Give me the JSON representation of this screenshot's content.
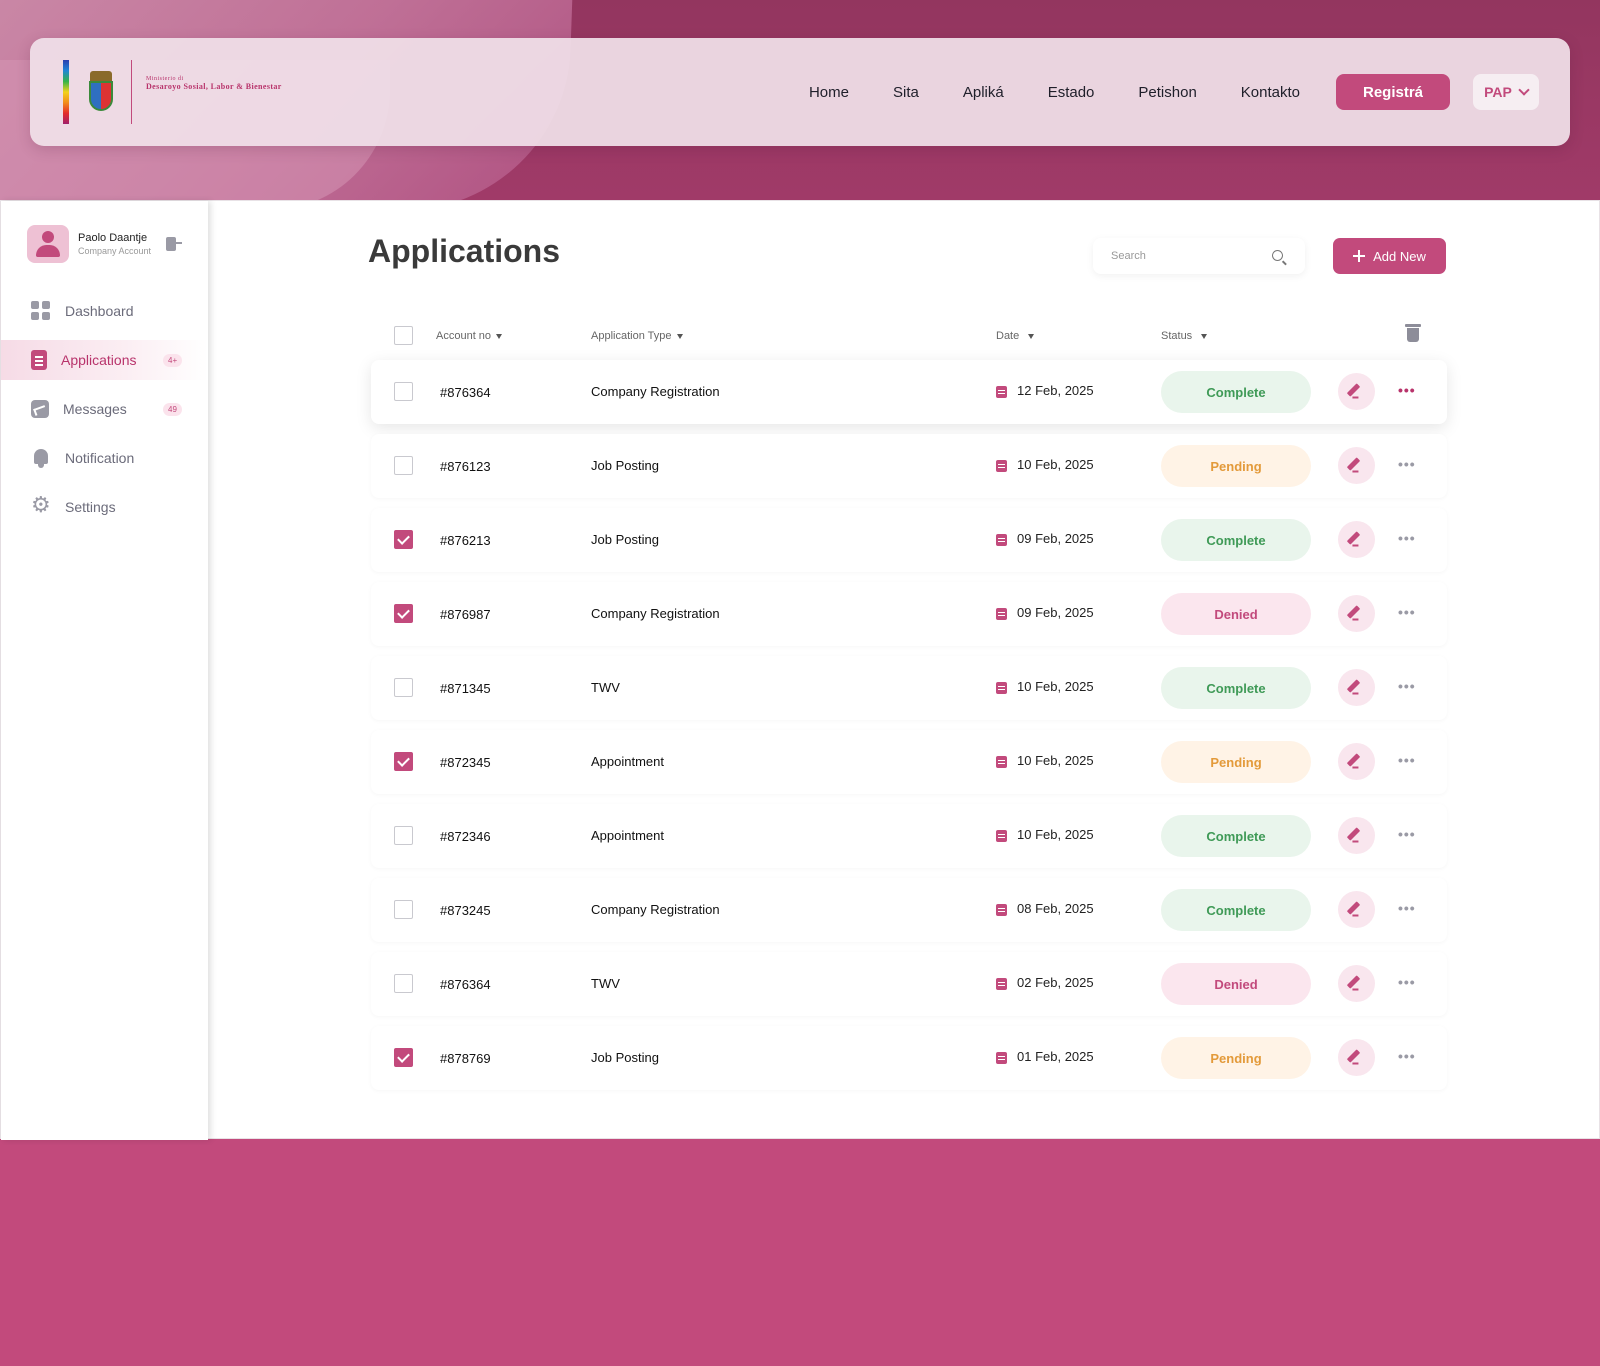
{
  "header": {
    "ministry_small": "Ministerio di",
    "ministry_name": "Desaroyo Sosial, Labor & Bienestar",
    "nav": [
      "Home",
      "Sita",
      "Apliká",
      "Estado",
      "Petishon",
      "Kontakto"
    ],
    "register_label": "Registrá",
    "language": "PAP"
  },
  "user": {
    "name": "Paolo Daantje",
    "role": "Company Account"
  },
  "sidebar": {
    "items": [
      {
        "label": "Dashboard",
        "icon": "grid-icon",
        "badge": ""
      },
      {
        "label": "Applications",
        "icon": "document-icon",
        "badge": "4+",
        "active": true
      },
      {
        "label": "Messages",
        "icon": "chart-message-icon",
        "badge": "49"
      },
      {
        "label": "Notification",
        "icon": "bell-icon",
        "badge": ""
      },
      {
        "label": "Settings",
        "icon": "gear-icon",
        "badge": ""
      }
    ]
  },
  "main": {
    "title": "Applications",
    "search_placeholder": "Search",
    "add_label": "Add New",
    "columns": {
      "account": "Account no",
      "type": "Application Type",
      "date": "Date",
      "status": "Status"
    },
    "rows": [
      {
        "account": "#876364",
        "type": "Company Registration",
        "date": "12 Feb, 2025",
        "status": "Complete",
        "checked": false
      },
      {
        "account": "#876123",
        "type": "Job Posting",
        "date": "10 Feb, 2025",
        "status": "Pending",
        "checked": false
      },
      {
        "account": "#876213",
        "type": "Job Posting",
        "date": "09 Feb, 2025",
        "status": "Complete",
        "checked": true
      },
      {
        "account": "#876987",
        "type": "Company Registration",
        "date": "09 Feb, 2025",
        "status": "Denied",
        "checked": true
      },
      {
        "account": "#871345",
        "type": "TWV",
        "date": "10 Feb, 2025",
        "status": "Complete",
        "checked": false
      },
      {
        "account": "#872345",
        "type": "Appointment",
        "date": "10 Feb, 2025",
        "status": "Pending",
        "checked": true
      },
      {
        "account": "#872346",
        "type": "Appointment",
        "date": "10 Feb, 2025",
        "status": "Complete",
        "checked": false
      },
      {
        "account": "#873245",
        "type": "Company Registration",
        "date": "08 Feb, 2025",
        "status": "Complete",
        "checked": false
      },
      {
        "account": "#876364",
        "type": "TWV",
        "date": "02 Feb, 2025",
        "status": "Denied",
        "checked": false
      },
      {
        "account": "#878769",
        "type": "Job Posting",
        "date": "01 Feb, 2025",
        "status": "Pending",
        "checked": true
      }
    ]
  },
  "colors": {
    "accent": "#c24a7c",
    "complete": "#3f9a57",
    "pending": "#e39a3a",
    "denied": "#c24a7c"
  }
}
